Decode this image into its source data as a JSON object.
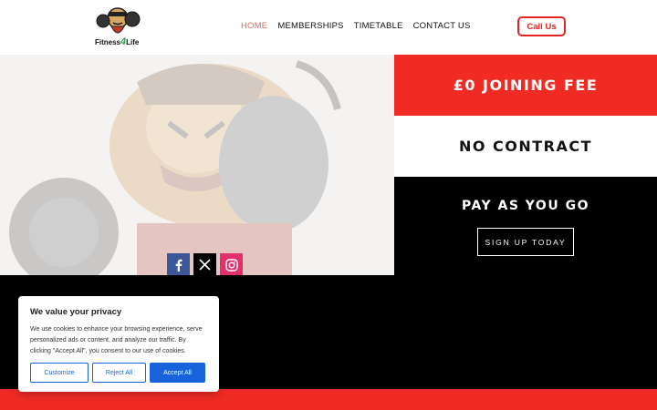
{
  "header": {
    "logo_text_a": "Fitness",
    "logo_text_b": "4",
    "logo_text_c": "Life",
    "nav": [
      {
        "label": "HOME",
        "active": true
      },
      {
        "label": "MEMBERSHIPS",
        "active": false
      },
      {
        "label": "TIMETABLE",
        "active": false
      },
      {
        "label": "CONTACT US",
        "active": false
      }
    ],
    "call_label": "Call Us"
  },
  "social": {
    "icons": [
      "facebook-icon",
      "x-icon",
      "instagram-icon"
    ]
  },
  "panels": {
    "joining": "£0 JOINING FEE",
    "contract": "NO CONTRACT",
    "pay": "PAY AS YOU GO",
    "signup": "SIGN UP TODAY"
  },
  "cookie": {
    "title": "We value your privacy",
    "body": "We use cookies to enhance your browsing experience, serve personalized ads or content, and analyze our traffic. By clicking \"Accept All\", you consent to our use of cookies.",
    "customize": "Customize",
    "reject": "Reject All",
    "accept": "Accept All"
  },
  "colors": {
    "brand_red": "#ef2b24",
    "nav_active": "#e06b5b",
    "cookie_blue": "#1863dc"
  }
}
